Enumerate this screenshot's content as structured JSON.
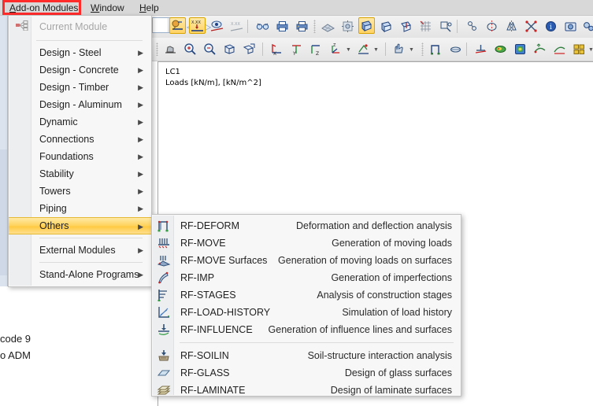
{
  "menubar": {
    "items": [
      {
        "label": "Add-on Modules",
        "accel": "A",
        "name": "menubar-addon-modules"
      },
      {
        "label": "Window",
        "accel": "W",
        "name": "menubar-window"
      },
      {
        "label": "Help",
        "accel": "H",
        "name": "menubar-help"
      }
    ]
  },
  "menu": {
    "current_module_label": "Current Module",
    "items": [
      {
        "label": "Design - Steel",
        "submenu": true,
        "highlighted": false
      },
      {
        "label": "Design - Concrete",
        "submenu": true,
        "highlighted": false
      },
      {
        "label": "Design - Timber",
        "submenu": true,
        "highlighted": false
      },
      {
        "label": "Design - Aluminum",
        "submenu": true,
        "highlighted": false
      },
      {
        "label": "Dynamic",
        "submenu": true,
        "highlighted": false
      },
      {
        "label": "Connections",
        "submenu": true,
        "highlighted": false
      },
      {
        "label": "Foundations",
        "submenu": true,
        "highlighted": false
      },
      {
        "label": "Stability",
        "submenu": true,
        "highlighted": false
      },
      {
        "label": "Towers",
        "submenu": true,
        "highlighted": false
      },
      {
        "label": "Piping",
        "submenu": true,
        "highlighted": false
      },
      {
        "label": "Others",
        "submenu": true,
        "highlighted": true
      },
      {
        "label": "External Modules",
        "submenu": true,
        "highlighted": false
      },
      {
        "label": "Stand-Alone Programs",
        "submenu": true,
        "highlighted": false
      }
    ],
    "arrow_glyph": "▶",
    "highlight_color": "#ffd257"
  },
  "submenu": {
    "items": [
      {
        "name": "RF-DEFORM",
        "desc": "Deformation and deflection analysis",
        "icon": "frame-deform-icon"
      },
      {
        "name": "RF-MOVE",
        "desc": "Generation of moving loads",
        "icon": "moving-load-icon"
      },
      {
        "name": "RF-MOVE Surfaces",
        "desc": "Generation of moving loads on surfaces",
        "icon": "moving-load-surface-icon"
      },
      {
        "name": "RF-IMP",
        "desc": "Generation of imperfections",
        "icon": "imperfection-icon"
      },
      {
        "name": "RF-STAGES",
        "desc": "Analysis of construction stages",
        "icon": "stages-icon"
      },
      {
        "name": "RF-LOAD-HISTORY",
        "desc": "Simulation of load history",
        "icon": "load-history-icon"
      },
      {
        "name": "RF-INFLUENCE",
        "desc": "Generation of influence lines and surfaces",
        "icon": "influence-line-icon"
      },
      {
        "name": "RF-SOILIN",
        "desc": "Soil-structure interaction analysis",
        "icon": "soil-icon"
      },
      {
        "name": "RF-GLASS",
        "desc": "Design of glass surfaces",
        "icon": "glass-surface-icon"
      },
      {
        "name": "RF-LAMINATE",
        "desc": "Design of laminate surfaces",
        "icon": "laminate-surface-icon"
      }
    ]
  },
  "viewport": {
    "line1": "LC1",
    "line2": "Loads [kN/m], [kN/m^2]"
  },
  "background_text": {
    "line1": "code 9",
    "line2": "o ADM"
  },
  "toolbar1": {
    "buttons": [
      {
        "name": "show-loads-values-button",
        "icon": "load-value-icon",
        "active": true
      },
      {
        "name": "show-numeric-values-button",
        "icon": "xxx-value-icon",
        "active": true
      },
      {
        "name": "show-result-values-button",
        "icon": "eye-result-icon",
        "active": false
      },
      {
        "name": "show-result-numbers-button",
        "icon": "xxx-result-icon",
        "active": false
      },
      {
        "name": "render-glasses-button",
        "icon": "glasses-icon",
        "active": false
      },
      {
        "name": "print-preview-button",
        "icon": "printer-icon",
        "active": false
      },
      {
        "name": "printout-report-button",
        "icon": "report-icon",
        "active": false
      },
      {
        "name": "mesh-view-button",
        "icon": "mesh-icon",
        "active": false
      },
      {
        "name": "solid-view-button",
        "icon": "sun-mesh-icon",
        "active": false
      },
      {
        "name": "model-wire-button",
        "icon": "model-blue-icon",
        "active": true
      },
      {
        "name": "model-section-button",
        "icon": "model-section-icon",
        "active": false
      },
      {
        "name": "model-solid-button",
        "icon": "model-solid-icon",
        "active": false
      },
      {
        "name": "grid-button",
        "icon": "grid-icon",
        "active": false
      },
      {
        "name": "snap-button",
        "icon": "snap-icon",
        "active": false
      },
      {
        "name": "node-select-button",
        "icon": "node-select-icon",
        "active": false
      },
      {
        "name": "rotate-button",
        "icon": "rotate-icon",
        "active": false
      },
      {
        "name": "mirror-button",
        "icon": "mirror-icon",
        "active": false
      },
      {
        "name": "scale-button",
        "icon": "scale-icon",
        "active": false
      },
      {
        "name": "info-button",
        "icon": "info-icon",
        "active": false
      },
      {
        "name": "camera-button",
        "icon": "camera-icon",
        "active": false
      },
      {
        "name": "settings-button",
        "icon": "gears-icon",
        "active": false
      }
    ],
    "combo_value": "",
    "nav_prev": "◁",
    "nav_next": "▷"
  },
  "toolbar2": {
    "buttons": [
      {
        "name": "zoom-pan-button",
        "icon": "pan-hand-icon",
        "active": false
      },
      {
        "name": "zoom-in-button",
        "icon": "zoom-in-icon",
        "active": false
      },
      {
        "name": "zoom-out-button",
        "icon": "zoom-out-icon",
        "active": false
      },
      {
        "name": "zoom-all-button",
        "icon": "zoom-all-icon",
        "active": false
      },
      {
        "name": "zoom-window-button",
        "icon": "zoom-window-icon",
        "active": false
      },
      {
        "name": "view-x-button",
        "icon": "axis-x-icon",
        "active": false
      },
      {
        "name": "view-y-button",
        "icon": "axis-y-icon",
        "active": false
      },
      {
        "name": "view-z-button",
        "icon": "axis-z-icon",
        "active": false
      },
      {
        "name": "view-iso-button",
        "icon": "axis-iso-icon",
        "active": false
      },
      {
        "name": "view-rotate-button",
        "icon": "view-rotate-icon",
        "active": false
      },
      {
        "name": "select-hand-button",
        "icon": "hand-select-icon",
        "active": false
      },
      {
        "name": "member-button",
        "icon": "member-frame-icon",
        "active": false
      },
      {
        "name": "surface-button",
        "icon": "surface-icon",
        "active": false
      },
      {
        "name": "support-button",
        "icon": "support-icon",
        "active": false
      },
      {
        "name": "results-surface-button",
        "icon": "results-surface-icon",
        "active": false
      },
      {
        "name": "results-solid-button",
        "icon": "results-solid-icon",
        "active": false
      },
      {
        "name": "deformation-button",
        "icon": "deformation-icon",
        "active": false
      },
      {
        "name": "diagram-button",
        "icon": "diagram-icon",
        "active": false
      },
      {
        "name": "panel-button",
        "icon": "panel-squares-icon",
        "active": false
      },
      {
        "name": "result-line-button",
        "icon": "result-line-icon",
        "active": false
      },
      {
        "name": "table-button",
        "icon": "table-icon",
        "active": false
      }
    ]
  }
}
